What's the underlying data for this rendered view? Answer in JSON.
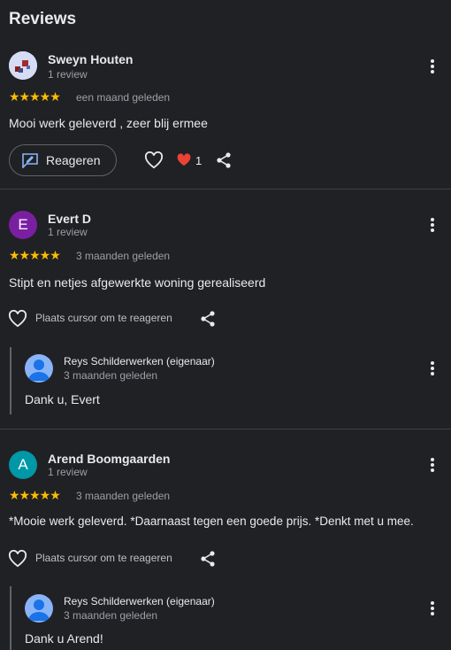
{
  "page": {
    "title": "Reviews"
  },
  "colors": {
    "star": "#fbbc04",
    "avatar_e": "#7b1fa2",
    "avatar_a": "#0097a7",
    "heart_red": "#ea4335"
  },
  "reviews": [
    {
      "name": "Sweyn Houten",
      "sub": "1 review",
      "stars": "★★★★★",
      "date": "een maand geleden",
      "text": "Mooi werk geleverd , zeer blij ermee",
      "reply_label": "Reageren",
      "like_count": "1"
    },
    {
      "name": "Evert D",
      "initial": "E",
      "sub": "1 review",
      "stars": "★★★★★",
      "date": "3 maanden geleden",
      "text": "Stipt en netjes afgewerkte woning gerealiseerd",
      "hint": "Plaats cursor om te reageren",
      "owner": {
        "name": "Reys Schilderwerken (eigenaar)",
        "date": "3 maanden geleden",
        "text": "Dank u, Evert"
      }
    },
    {
      "name": "Arend Boomgaarden",
      "initial": "A",
      "sub": "1 review",
      "stars": "★★★★★",
      "date": "3 maanden geleden",
      "text": "*Mooie werk geleverd. *Daarnaast tegen een goede prijs. *Denkt met u mee.",
      "hint": "Plaats cursor om te reageren",
      "owner": {
        "name": "Reys Schilderwerken (eigenaar)",
        "date": "3 maanden geleden",
        "text": "Dank u Arend!"
      }
    }
  ]
}
